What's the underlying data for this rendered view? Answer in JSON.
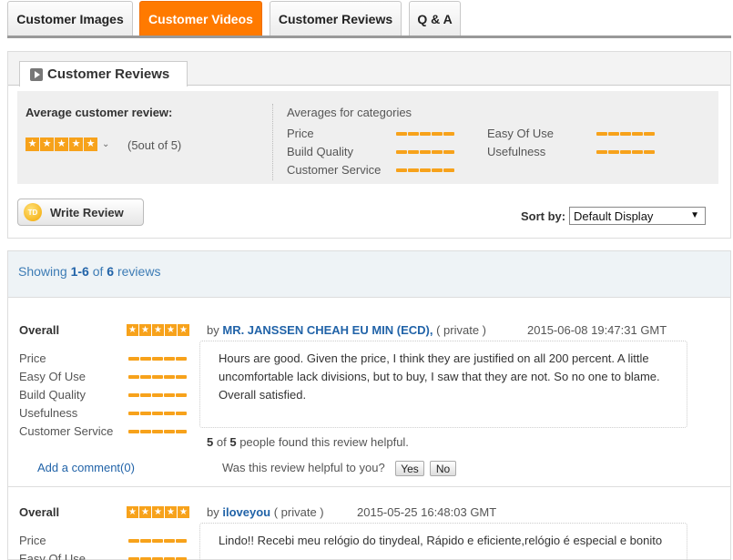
{
  "tabs": [
    {
      "label": "Customer Images",
      "active": false
    },
    {
      "label": "Customer Videos",
      "active": true
    },
    {
      "label": "Customer Reviews",
      "active": false
    },
    {
      "label": "Q & A",
      "active": false
    }
  ],
  "reviews_panel": {
    "title": "Customer Reviews",
    "average_label": "Average customer review:",
    "average_stars": 5,
    "average_text": "(5out of 5)",
    "categories_title": "Averages for categories",
    "categories": [
      {
        "label": "Price",
        "stars": 5
      },
      {
        "label": "Easy Of Use",
        "stars": 5
      },
      {
        "label": "Build Quality",
        "stars": 5
      },
      {
        "label": "Usefulness",
        "stars": 5
      },
      {
        "label": "Customer Service",
        "stars": 5
      }
    ],
    "write_review_label": "Write Review",
    "write_review_icon": "TD",
    "sort_label": "Sort by:",
    "sort_value": "Default Display"
  },
  "listing": {
    "showing_prefix": "Showing",
    "showing_range": "1-6",
    "showing_of": "of",
    "showing_total": "6",
    "showing_suffix": "reviews"
  },
  "reviews": [
    {
      "overall_label": "Overall",
      "overall_stars": 5,
      "by": "by",
      "author": "MR. JANSSEN CHEAH EU MIN (ECD),",
      "privacy": "( private )",
      "date": "2015-06-08 19:47:31 GMT",
      "categories": [
        {
          "label": "Price",
          "stars": 5
        },
        {
          "label": "Easy Of Use",
          "stars": 5
        },
        {
          "label": "Build Quality",
          "stars": 5
        },
        {
          "label": "Usefulness",
          "stars": 5
        },
        {
          "label": "Customer Service",
          "stars": 5
        }
      ],
      "body": "Hours are good. Given the price, I think they are justified on all 200 percent. A little uncomfortable lack divisions, but to buy, I saw that they are not. So no one to blame. Overall satisfied.",
      "helpful_count": "5",
      "helpful_of": "of",
      "helpful_total": "5",
      "helpful_suffix": "people found this review helpful.",
      "add_comment": "Add a comment(0)",
      "was_helpful": "Was this review helpful to you?",
      "yes": "Yes",
      "no": "No"
    },
    {
      "overall_label": "Overall",
      "overall_stars": 5,
      "by": "by",
      "author": "iloveyou",
      "privacy": "( private )",
      "date": "2015-05-25 16:48:03 GMT",
      "categories": [
        {
          "label": "Price",
          "stars": 5
        },
        {
          "label": "Easy Of Use",
          "stars": 5
        }
      ],
      "body": "Lindo!! Recebi meu relógio do tinydeal, Rápido e eficiente,relógio é especial e bonito"
    }
  ],
  "colors": {
    "accent": "#ff7a00",
    "star": "#f7a21b",
    "link": "#2163a8"
  }
}
